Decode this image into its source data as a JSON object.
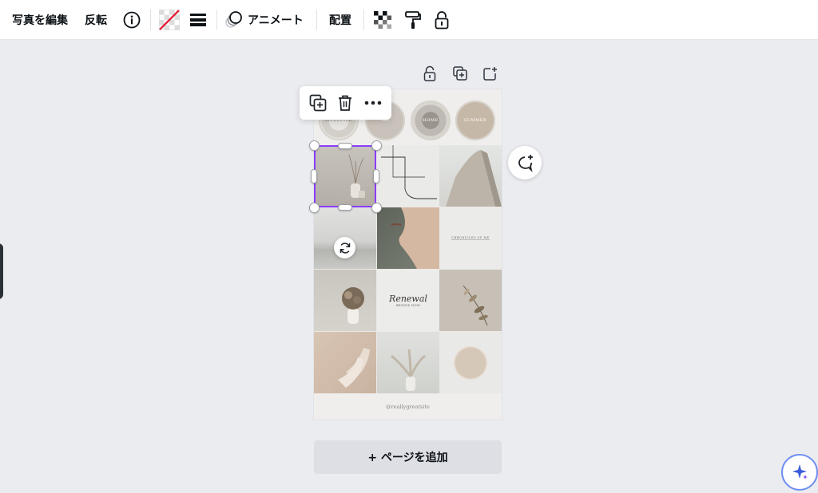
{
  "toolbar": {
    "edit_photo": "写真を編集",
    "flip": "反転",
    "animate": "アニメート",
    "position": "配置",
    "icons": [
      "info-icon",
      "transparency-swatch-icon",
      "line-weight-icon",
      "animate-icon",
      "checker-transparency-icon",
      "paint-roller-icon",
      "lock-icon"
    ]
  },
  "design": {
    "badges": [
      "LIFESTYLE",
      "ME",
      "HOME",
      "SUMMER"
    ],
    "chronicles_label": "CHRONICLES OF ME",
    "renewal_title": "Renewal",
    "renewal_sub": "BEGINS NOW",
    "footer_handle": "@reallygreatsite"
  },
  "add_page_label": "+ ページを追加",
  "colors": {
    "accent": "#8b3dff",
    "magic": "#6f8ff0"
  }
}
